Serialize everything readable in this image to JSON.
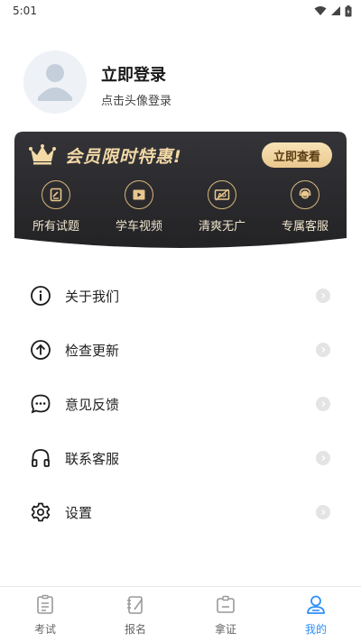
{
  "status_bar": {
    "time": "5:01"
  },
  "profile": {
    "title": "立即登录",
    "subtitle": "点击头像登录"
  },
  "vip": {
    "title": "会员限时特惠!",
    "button_label": "立即查看",
    "features": [
      {
        "label": "所有试题",
        "icon": "document-icon"
      },
      {
        "label": "学车视频",
        "icon": "video-icon"
      },
      {
        "label": "清爽无广",
        "icon": "no-ads-icon"
      },
      {
        "label": "专属客服",
        "icon": "headset-icon"
      }
    ],
    "accent": "#e9c88e",
    "background": "#2a2a2e"
  },
  "menu": [
    {
      "label": "关于我们",
      "icon": "info-icon"
    },
    {
      "label": "检查更新",
      "icon": "upload-icon"
    },
    {
      "label": "意见反馈",
      "icon": "chat-icon"
    },
    {
      "label": "联系客服",
      "icon": "headphones-icon"
    },
    {
      "label": "设置",
      "icon": "gear-icon"
    }
  ],
  "tabs": [
    {
      "label": "考试",
      "icon": "exam-icon",
      "active": false
    },
    {
      "label": "报名",
      "icon": "signup-icon",
      "active": false
    },
    {
      "label": "拿证",
      "icon": "license-icon",
      "active": false
    },
    {
      "label": "我的",
      "icon": "profile-icon",
      "active": true
    }
  ],
  "colors": {
    "active_tab": "#2f8ef8"
  }
}
